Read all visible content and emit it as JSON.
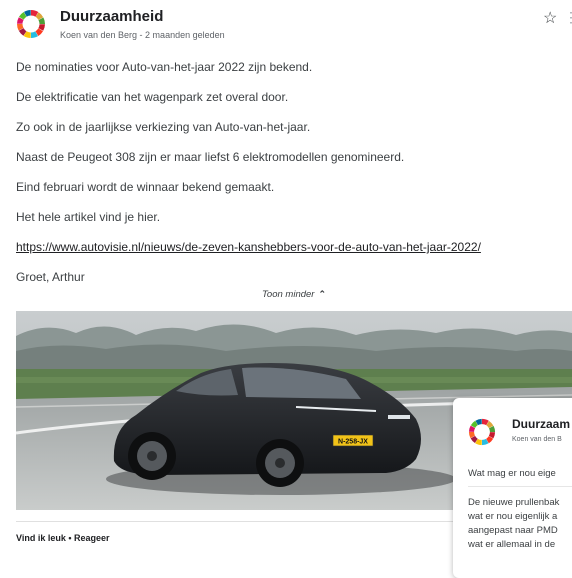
{
  "post": {
    "title": "Duurzaamheid",
    "meta": "Koen van den Berg - 2 maanden geleden",
    "paragraphs": [
      "De nominaties voor Auto-van-het-jaar 2022 zijn bekend.",
      "De elektrificatie van het wagenpark zet overal door.",
      "Zo ook in de jaarlijkse verkiezing van Auto-van-het-jaar.",
      "Naast de Peugeot 308 zijn er maar liefst 6 elektromodellen genomineerd.",
      "Eind februari wordt de winnaar bekend gemaakt.",
      "Het hele artikel vind je hier."
    ],
    "link": "https://www.autovisie.nl/nieuws/de-zeven-kanshebbers-voor-de-auto-van-het-jaar-2022/",
    "signature": "Groet, Arthur",
    "show_less": "Toon minder",
    "plate": "N-258-JX",
    "actions": "Vind ik leuk • Reageer"
  },
  "popup_card": {
    "title": "Duurzaam",
    "meta": "Koen van den B",
    "question": "Wat mag er nou eige",
    "lines": [
      "De nieuwe prullenbak",
      "wat er nou eigenlijk a",
      "aangepast naar PMD",
      "wat er allemaal in de"
    ]
  },
  "icons": {
    "star": "star-outline-icon",
    "more": "more-vert-icon",
    "chevron": "chevron-up-icon",
    "logo": "sdg-color-wheel-icon"
  }
}
